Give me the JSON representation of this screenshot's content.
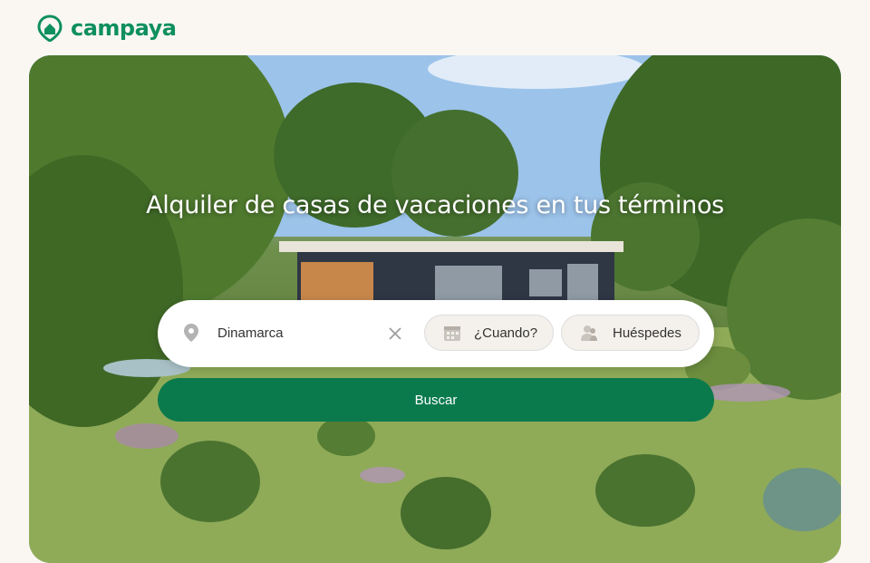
{
  "brand": {
    "name": "campaya",
    "color": "#0e8f5f",
    "icon": "house-pin-icon"
  },
  "hero": {
    "headline": "Alquiler de casas de vacaciones en tus términos"
  },
  "search": {
    "location_value": "Dinamarca",
    "location_icon": "map-pin-icon",
    "clear_icon": "close-icon",
    "when_label": "¿Cuando?",
    "when_icon": "calendar-icon",
    "guests_label": "Huéspedes",
    "guests_icon": "people-icon",
    "submit_label": "Buscar",
    "submit_color": "#0a7a4d"
  }
}
